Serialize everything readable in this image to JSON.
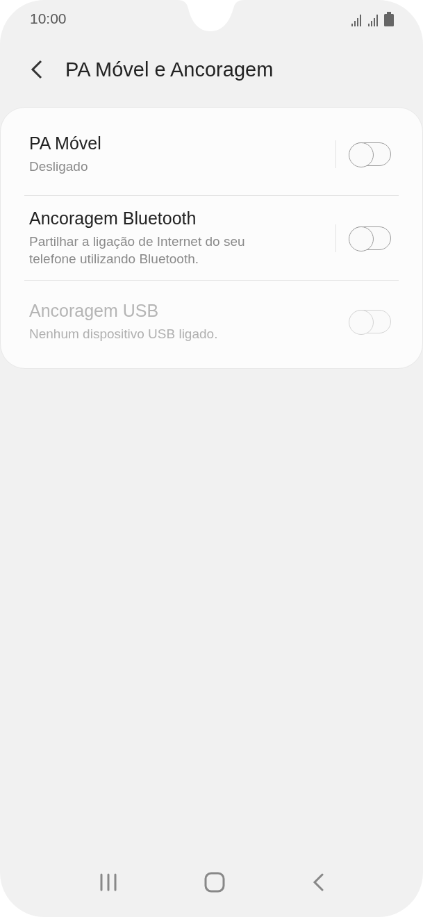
{
  "status_bar": {
    "time": "10:00"
  },
  "header": {
    "title": "PA Móvel e Ancoragem"
  },
  "settings": [
    {
      "title": "PA Móvel",
      "subtitle": "Desligado",
      "on": false,
      "disabled": false
    },
    {
      "title": "Ancoragem Bluetooth",
      "subtitle": "Partilhar a ligação de Internet do seu telefone utilizando Bluetooth.",
      "on": false,
      "disabled": false
    },
    {
      "title": "Ancoragem USB",
      "subtitle": "Nenhum dispositivo USB ligado.",
      "on": false,
      "disabled": true
    }
  ]
}
